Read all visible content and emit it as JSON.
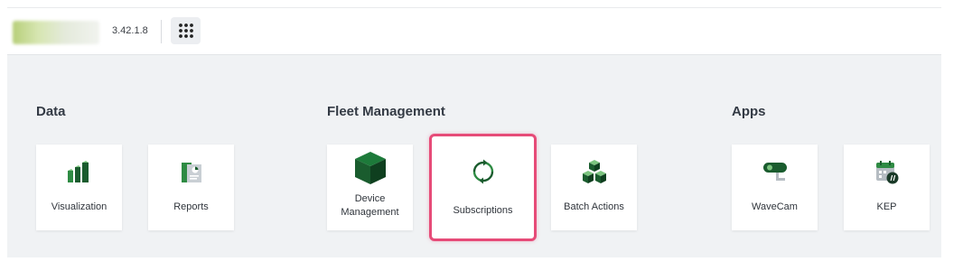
{
  "header": {
    "version": "3.42.1.8",
    "apps_menu_icon": "grid-dots-icon"
  },
  "sections": [
    {
      "title": "Data",
      "tiles": [
        {
          "label": "Visualization",
          "icon": "bar-chart-icon"
        },
        {
          "label": "Reports",
          "icon": "report-document-icon"
        }
      ]
    },
    {
      "title": "Fleet Management",
      "tiles": [
        {
          "label": "Device Management",
          "icon": "cube-icon"
        },
        {
          "label": "Subscriptions",
          "icon": "refresh-cycle-icon"
        },
        {
          "label": "Batch Actions",
          "icon": "stacked-cubes-icon"
        }
      ]
    },
    {
      "title": "Apps",
      "tiles": [
        {
          "label": "WaveCam",
          "icon": "camera-icon"
        },
        {
          "label": "KEP",
          "icon": "calendar-icon"
        }
      ]
    }
  ],
  "colors": {
    "brand_dark_green": "#1a5c2e",
    "brand_green": "#2e8b43",
    "highlight": "#e64b78",
    "background": "#f0f2f4"
  }
}
